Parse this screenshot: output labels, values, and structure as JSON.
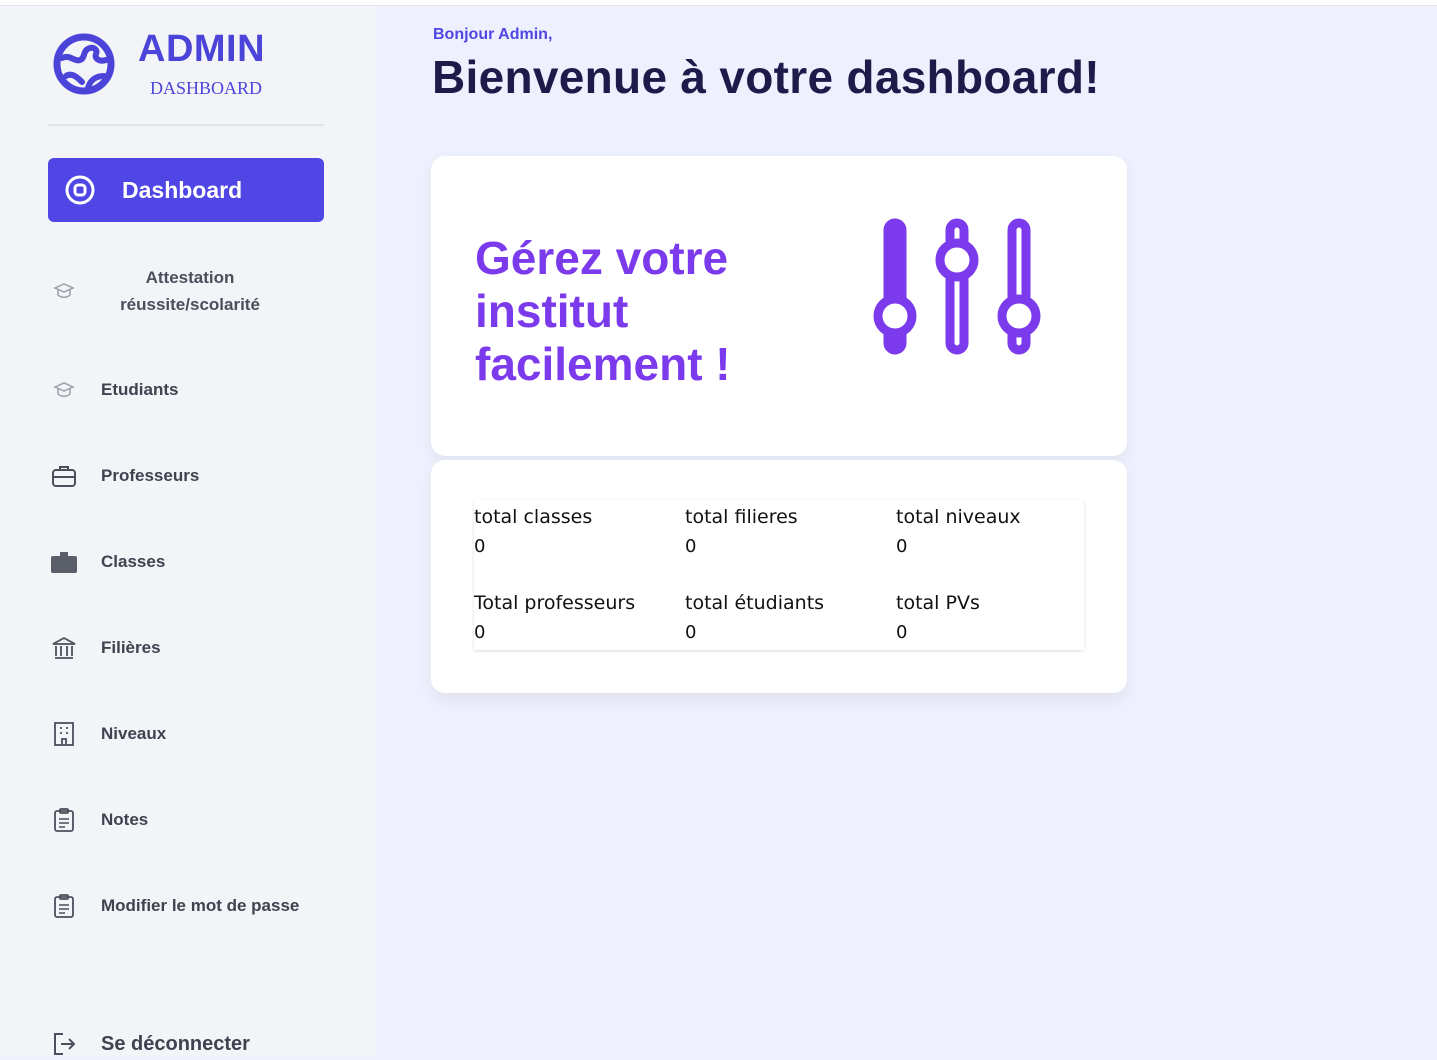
{
  "brand": {
    "title": "ADMIN",
    "subtitle": "DASHBOARD",
    "logo_icon": "globe-icon",
    "accent": "#4f46e5"
  },
  "nav": [
    {
      "label": "Dashboard",
      "icon": "target-icon",
      "active": true
    },
    {
      "label": "Attestation réussite/scolarité",
      "icon": "graduation-cap-icon"
    },
    {
      "label": "Etudiants",
      "icon": "graduation-cap-icon"
    },
    {
      "label": "Professeurs",
      "icon": "briefcase-icon"
    },
    {
      "label": "Classes",
      "icon": "case-icon"
    },
    {
      "label": "Filières",
      "icon": "bank-icon"
    },
    {
      "label": "Niveaux",
      "icon": "building-icon"
    },
    {
      "label": "Notes",
      "icon": "clipboard-icon"
    },
    {
      "label": "Modifier le mot de passe",
      "icon": "clipboard-icon"
    },
    {
      "label": "Se déconnecter",
      "icon": "logout-icon"
    }
  ],
  "header": {
    "greeting": "Bonjour Admin,",
    "title": "Bienvenue à votre dashboard!"
  },
  "hero": {
    "text": "Gérez votre institut facilement !",
    "icon": "sliders-icon",
    "color": "#7c3aed"
  },
  "stats": [
    {
      "label": "total classes",
      "value": "0"
    },
    {
      "label": "total filieres",
      "value": "0"
    },
    {
      "label": "total niveaux",
      "value": "0"
    },
    {
      "label": "Total professeurs",
      "value": "0"
    },
    {
      "label": "total étudiants",
      "value": "0"
    },
    {
      "label": "total PVs",
      "value": "0"
    }
  ]
}
